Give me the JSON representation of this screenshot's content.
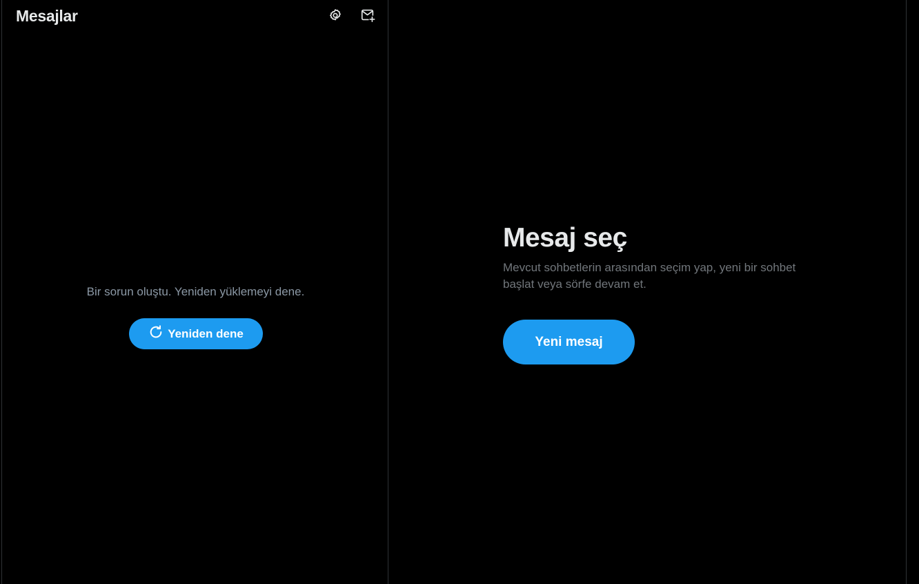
{
  "header": {
    "title": "Mesajlar",
    "settings_icon": "gear-icon",
    "compose_icon": "new-message-envelope-icon"
  },
  "error": {
    "message": "Bir sorun oluştu. Yeniden yüklemeyi dene.",
    "retry_label": "Yeniden dene",
    "retry_icon": "refresh-icon"
  },
  "detail": {
    "title": "Mesaj seç",
    "description": "Mevcut sohbetlerin arasından seçim yap, yeni bir sohbet başlat veya sörfe devam et.",
    "new_message_label": "Yeni mesaj"
  },
  "colors": {
    "background": "#000000",
    "accent": "#1d9bf0",
    "text_primary": "#e7e9ea",
    "text_secondary": "#71767b",
    "border": "#2f3336"
  }
}
